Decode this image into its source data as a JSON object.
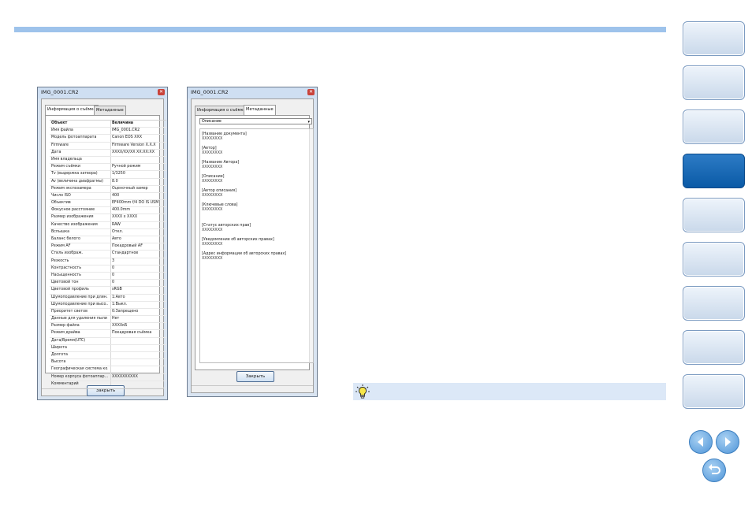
{
  "dialog_left": {
    "title": "IMG_0001.CR2",
    "tabs": [
      "Информация о съёмке",
      "Метаданные"
    ],
    "table_header": {
      "key": "Объект",
      "value": "Величина"
    },
    "rows": [
      [
        "Имя файла",
        "IMG_0001.CR2"
      ],
      [
        "Модель фотоаппарата",
        "Canon EOS XXX"
      ],
      [
        "Firmware",
        "Firmware Version X.X.X"
      ],
      [
        "Дата",
        "XXXX/XX/XX XX:XX:XX"
      ],
      [
        "Имя владельца",
        ""
      ],
      [
        "Режим съёмки",
        "Ручной режим"
      ],
      [
        "Tv (выдержка затвора)",
        "1/3250"
      ],
      [
        "Av (величина диафрагмы)",
        "8.0"
      ],
      [
        "Режим экспозамера",
        "Оценочный замер"
      ],
      [
        "Число ISO",
        "400"
      ],
      [
        "Объектив",
        "EF400mm f/4 DO IS USM"
      ],
      [
        "Фокусное расстояние",
        "400.0mm"
      ],
      [
        "Размер изображения",
        "XXXX x XXXX"
      ],
      [
        "Качество изображения",
        "RAW"
      ],
      [
        "Вспышка",
        "Откл."
      ],
      [
        "Баланс белого",
        "Авто"
      ],
      [
        "Режим AF",
        "Покадровый AF"
      ],
      [
        "Стиль изображ.",
        "Стандартное"
      ],
      [
        "Резкость",
        "3"
      ],
      [
        "Контрастность",
        "0"
      ],
      [
        "Насыщенность",
        "0"
      ],
      [
        "Цветовой тон",
        "0"
      ],
      [
        "Цветовой профиль",
        "sRGB"
      ],
      [
        "Шумоподавление при длин...",
        "1:Авто"
      ],
      [
        "Шумоподавление при высо...",
        "1:Выкл."
      ],
      [
        "Приоритет светов",
        "0:Запрещено"
      ],
      [
        "Данные для удаления пыли",
        "Нет"
      ],
      [
        "Размер файла",
        "XXXXкБ"
      ],
      [
        "Режим драйва",
        "Покадровая съёмка"
      ],
      [
        "Дата/Время(UTC)",
        ""
      ],
      [
        "Широта",
        ""
      ],
      [
        "Долгота",
        ""
      ],
      [
        "Высота",
        ""
      ],
      [
        "Географическая система ко...",
        ""
      ],
      [
        "Номер корпуса фотоаппар...",
        "XXXXXXXXXX"
      ],
      [
        "Комментарий",
        ""
      ]
    ],
    "close_label": "Закрыть"
  },
  "dialog_right": {
    "title": "IMG_0001.CR2",
    "tabs": [
      "Информация о съёмке",
      "Метаданные"
    ],
    "dropdown_value": "Описание",
    "fields": [
      {
        "label": "[Название документа]",
        "value": "XXXXXXXX"
      },
      {
        "label": "[Автор]",
        "value": "XXXXXXXX"
      },
      {
        "label": "[Название Автора]",
        "value": "XXXXXXXX"
      },
      {
        "label": "[Описание]",
        "value": "XXXXXXXX"
      },
      {
        "label": "[Автор описания]",
        "value": "XXXXXXXX"
      },
      {
        "label": "[Ключевые слова]",
        "value": "XXXXXXXX"
      },
      {
        "label": "[Статус авторских прав]",
        "value": "XXXXXXXX"
      },
      {
        "label": "[Уведомление об авторских правах]",
        "value": "XXXXXXXX"
      },
      {
        "label": "[Адрес информации об авторских правах]",
        "value": "XXXXXXXX"
      }
    ],
    "close_label": "Закрыть"
  },
  "side_nav": {
    "buttons": [
      "",
      "",
      "",
      "",
      "",
      "",
      "",
      "",
      ""
    ],
    "active_index": 3,
    "icons": [
      "arrow-left-icon",
      "arrow-right-icon",
      "return-icon"
    ]
  },
  "colors": {
    "accent_bar": "#9ec3eb",
    "nav_active": "#0a5aa6",
    "tip_bar": "#dce8f7"
  }
}
